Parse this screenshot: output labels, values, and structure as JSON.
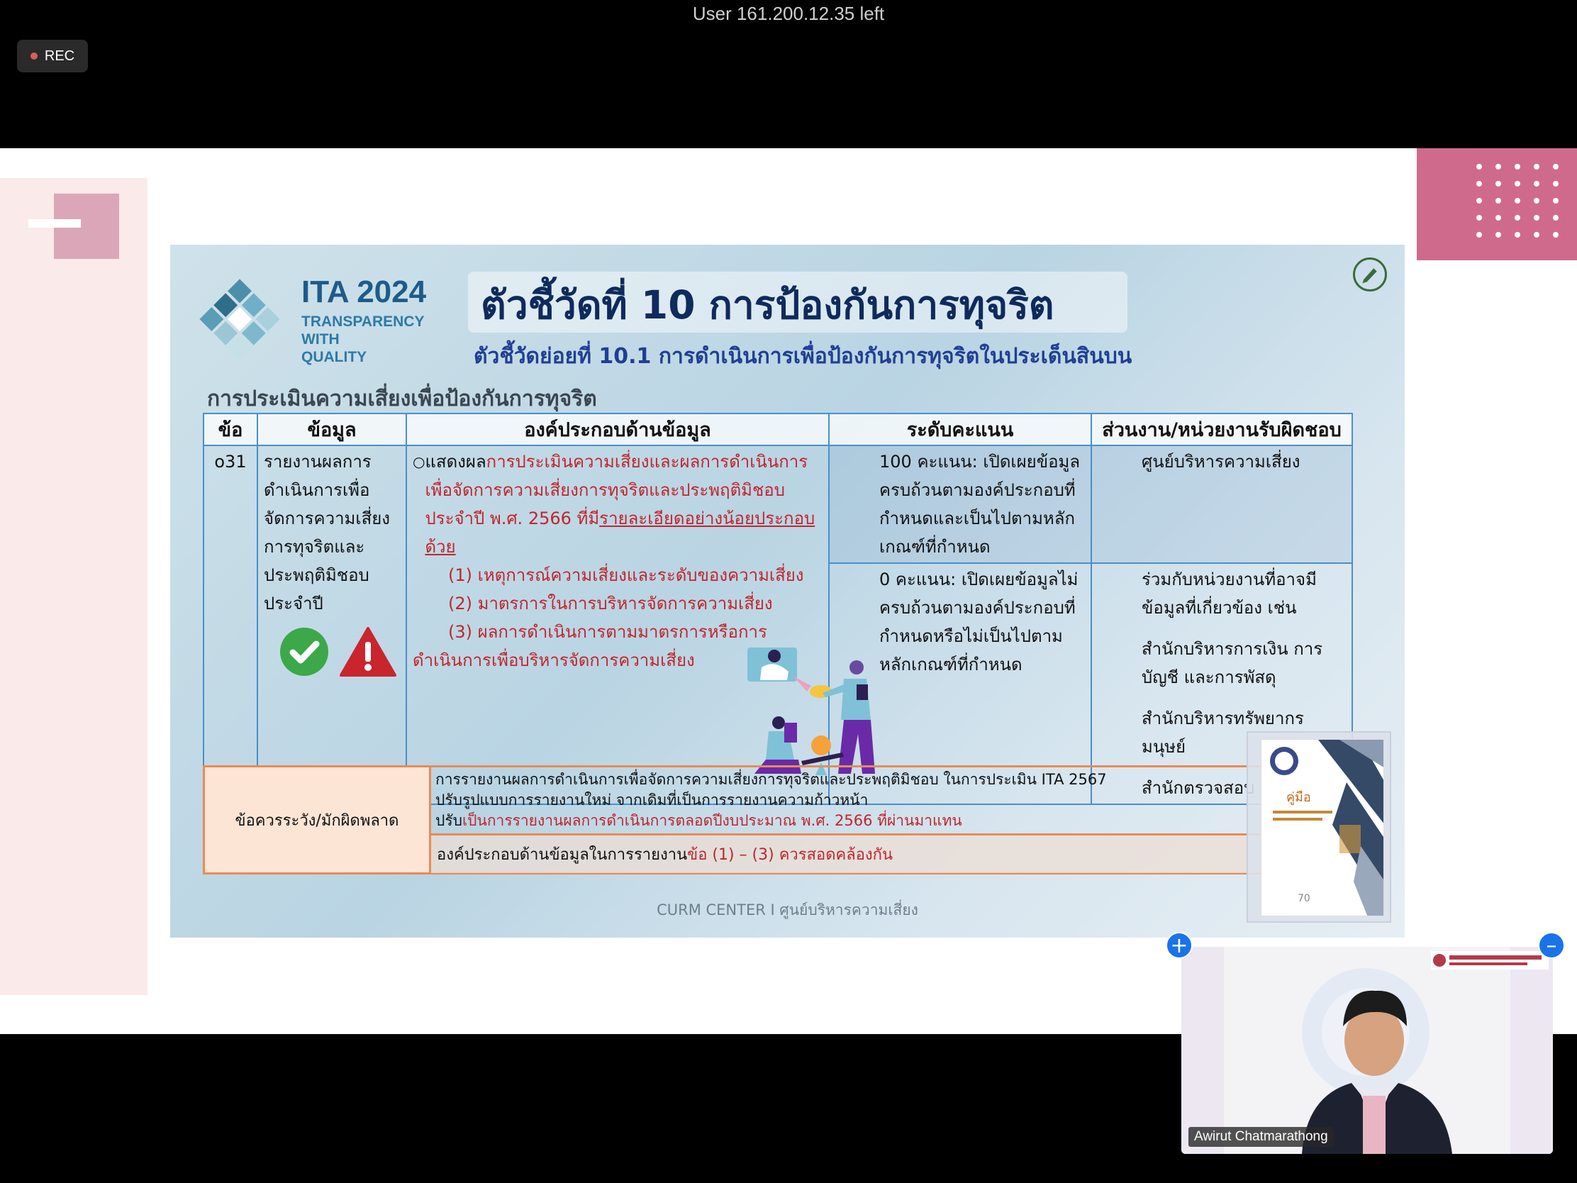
{
  "meeting": {
    "notice": "User 161.200.12.35 left",
    "rec_label": "REC"
  },
  "slide": {
    "logo": {
      "title": "ITA 2024",
      "tagline": "TRANSPARENCY\nWITH\nQUALITY"
    },
    "title": "ตัวชี้วัดที่ 10 การป้องกันการทุจริต",
    "subtitle": "ตัวชี้วัดย่อยที่ 10.1 การดำเนินการเพื่อป้องกันการทุจริตในประเด็นสินบน",
    "section_title": "การประเมินความเสี่ยงเพื่อป้องกันการทุจริต",
    "table": {
      "headers": [
        "ข้อ",
        "ข้อมูล",
        "องค์ประกอบด้านข้อมูล",
        "ระดับคะแนน",
        "ส่วนงาน/หน่วยงานรับผิดชอบ"
      ],
      "item_no": "o31",
      "info": "รายงานผลการดำเนินการเพื่อจัดการความเสี่ยงการทุจริตและประพฤติมิชอบประจำปี",
      "bullet": "○",
      "comp_intro": "แสดงผล",
      "comp_red1": "การประเมินความเสี่ยงและผลการดำเนินการเพื่อจัดการความเสี่ยงการทุจริตและประพฤติมิชอบ",
      "comp_year": "ประจำปี พ.ศ. 2566 ที่มี",
      "comp_underline": "รายละเอียดอย่างน้อยประกอบด้วย",
      "comp_items": [
        "(1) เหตุการณ์ความเสี่ยงและระดับของความเสี่ยง",
        "(2) มาตรการในการบริหารจัดการความเสี่ยง",
        "(3) ผลการดำเนินการตามมาตรการหรือการ"
      ],
      "comp_tail": "ดำเนินการเพื่อบริหารจัดการความเสี่ยง",
      "score_100": "100 คะแนน: เปิดเผยข้อมูลครบถ้วนตามองค์ประกอบที่กำหนดและเป็นไปตามหลักเกณฑ์ที่กำหนด",
      "score_0": "0 คะแนน: เปิดเผยข้อมูลไม่ครบถ้วนตามองค์ประกอบที่กำหนดหรือไม่เป็นไปตามหลักเกณฑ์ที่กำหนด",
      "resp_main": "ศูนย์บริหารความเสี่ยง",
      "resp_with": "ร่วมกับหน่วยงานที่อาจมีข้อมูลที่เกี่ยวข้อง เช่น",
      "resp_list": [
        "สำนักบริหารการเงิน การบัญชี และการพัสดุ",
        "สำนักบริหารทรัพยากรมนุษย์",
        "สำนักตรวจสอบ"
      ]
    },
    "warning": {
      "label": "ข้อควรระวัง/มักผิดพลาด",
      "line1": "การรายงานผลการดำเนินการเพื่อจัดการความเสี่ยงการทุจริตและประพฤติมิชอบ ในการประเมิน ITA 2567",
      "line2": "ปรับรูปแบบการรายงานใหม่ จากเดิมที่เป็นการรายงานความก้าวหน้า",
      "line3_prefix": "ปรับ",
      "line3_red": "เป็นการรายงานผลการดำเนินการตลอดปีงบประมาณ พ.ศ. 2566 ที่ผ่านมาแทน",
      "line4_prefix": "องค์ประกอบด้านข้อมูลในการรายงาน",
      "line4_red": "ข้อ (1) – (3) ควรสอดคล้องกัน"
    },
    "footer": "CURM CENTER I ศูนย์บริหารความเสี่ยง",
    "book_title": "คู่มือ",
    "book_page": "70"
  },
  "video": {
    "participant_name": "Awirut Chatmarathong"
  },
  "colors": {
    "accent_red": "#c0262d",
    "table_border": "#4a8fc8",
    "warning_border": "#ea8b52",
    "title_navy": "#0f2a5c"
  }
}
